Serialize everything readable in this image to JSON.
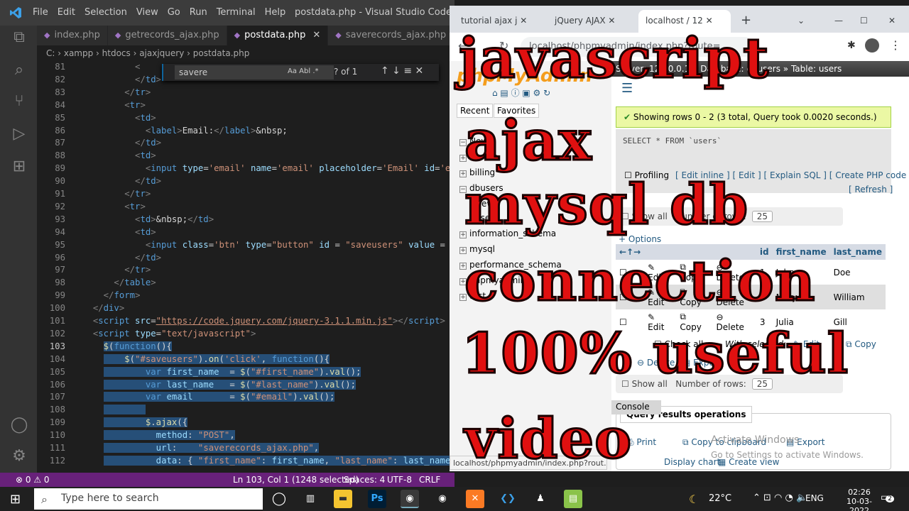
{
  "vscode": {
    "menu": [
      "File",
      "Edit",
      "Selection",
      "View",
      "Go",
      "Run",
      "Terminal",
      "Help"
    ],
    "window_title": "postdata.php - Visual Studio Code",
    "tabs": [
      {
        "label": "index.php",
        "active": false
      },
      {
        "label": "getrecords_ajax.php",
        "active": false
      },
      {
        "label": "postdata.php",
        "active": true
      },
      {
        "label": "saverecords_ajax.php",
        "active": false
      }
    ],
    "breadcrumb": "C: › xampp › htdocs › ajaxjquery › postdata.php",
    "find": {
      "query": "savere",
      "case": "Aa",
      "word": "Abl",
      "regex": ".*",
      "count": "? of 1",
      "arrows": "↑ ↓ ≡ ✕"
    },
    "lines": [
      {
        "n": "81",
        "html": "          <span class='t-punc'>&lt;</span>"
      },
      {
        "n": "82",
        "html": "          <span class='t-punc'>&lt;/</span><span class='t-tag'>td</span><span class='t-punc'>&gt;</span>"
      },
      {
        "n": "83",
        "html": "        <span class='t-punc'>&lt;/</span><span class='t-tag'>tr</span><span class='t-punc'>&gt;</span>"
      },
      {
        "n": "84",
        "html": "        <span class='t-punc'>&lt;</span><span class='t-tag'>tr</span><span class='t-punc'>&gt;</span>"
      },
      {
        "n": "85",
        "html": "          <span class='t-punc'>&lt;</span><span class='t-tag'>td</span><span class='t-punc'>&gt;</span>"
      },
      {
        "n": "86",
        "html": "            <span class='t-punc'>&lt;</span><span class='t-tag'>label</span><span class='t-punc'>&gt;</span>Email:<span class='t-punc'>&lt;/</span><span class='t-tag'>label</span><span class='t-punc'>&gt;</span>&amp;nbsp;"
      },
      {
        "n": "87",
        "html": "          <span class='t-punc'>&lt;/</span><span class='t-tag'>td</span><span class='t-punc'>&gt;</span>"
      },
      {
        "n": "88",
        "html": "          <span class='t-punc'>&lt;</span><span class='t-tag'>td</span><span class='t-punc'>&gt;</span>"
      },
      {
        "n": "89",
        "html": "            <span class='t-punc'>&lt;</span><span class='t-tag'>input</span> <span class='t-attr'>type</span>=<span class='t-str'>'email'</span> <span class='t-attr'>name</span>=<span class='t-str'>'email'</span> <span class='t-attr'>placeholder</span>=<span class='t-str'>'Email'</span> <span class='t-attr'>id</span>=<span class='t-str'>'e</span>"
      },
      {
        "n": "90",
        "html": "          <span class='t-punc'>&lt;/</span><span class='t-tag'>td</span><span class='t-punc'>&gt;</span>"
      },
      {
        "n": "91",
        "html": "        <span class='t-punc'>&lt;/</span><span class='t-tag'>tr</span><span class='t-punc'>&gt;</span>"
      },
      {
        "n": "92",
        "html": "        <span class='t-punc'>&lt;</span><span class='t-tag'>tr</span><span class='t-punc'>&gt;</span>"
      },
      {
        "n": "93",
        "html": "          <span class='t-punc'>&lt;</span><span class='t-tag'>td</span><span class='t-punc'>&gt;</span>&amp;nbsp;<span class='t-punc'>&lt;/</span><span class='t-tag'>td</span><span class='t-punc'>&gt;</span>"
      },
      {
        "n": "94",
        "html": "          <span class='t-punc'>&lt;</span><span class='t-tag'>td</span><span class='t-punc'>&gt;</span>"
      },
      {
        "n": "95",
        "html": "            <span class='t-punc'>&lt;</span><span class='t-tag'>input</span> <span class='t-attr'>class</span>=<span class='t-str'>'btn'</span> <span class='t-attr'>type</span>=<span class='t-str'>\"button\"</span> <span class='t-attr'>id</span> = <span class='t-str'>\"saveusers\"</span> <span class='t-attr'>value</span> ="
      },
      {
        "n": "96",
        "html": "          <span class='t-punc'>&lt;/</span><span class='t-tag'>td</span><span class='t-punc'>&gt;</span>"
      },
      {
        "n": "97",
        "html": "        <span class='t-punc'>&lt;/</span><span class='t-tag'>tr</span><span class='t-punc'>&gt;</span>"
      },
      {
        "n": "98",
        "html": "      <span class='t-punc'>&lt;/</span><span class='t-tag'>table</span><span class='t-punc'>&gt;</span>"
      },
      {
        "n": "99",
        "html": "    <span class='t-punc'>&lt;/</span><span class='t-tag'>form</span><span class='t-punc'>&gt;</span>"
      },
      {
        "n": "100",
        "html": "  <span class='t-punc'>&lt;/</span><span class='t-tag'>div</span><span class='t-punc'>&gt;</span>"
      },
      {
        "n": "101",
        "html": "  <span class='t-punc'>&lt;</span><span class='t-tag'>script</span> <span class='t-attr'>src</span>=<span class='t-str' style='text-decoration:underline'>\"https://code.jquery.com/jquery-3.1.1.min.js\"</span><span class='t-punc'>&gt;&lt;/</span><span class='t-tag'>script</span><span class='t-punc'>&gt;</span>"
      },
      {
        "n": "102",
        "html": "  <span class='t-punc'>&lt;</span><span class='t-tag'>script</span> <span class='t-attr'>type</span>=<span class='t-str'>\"text/javascript\"</span><span class='t-punc'>&gt;</span>"
      },
      {
        "n": "103",
        "html": "    <span class='sel'><span class='t-fn'>$</span>(<span class='t-kw'>function</span>(){</span>",
        "cur": true
      },
      {
        "n": "104",
        "html": "    <span class='sel'>    <span class='t-fn'>$</span>(<span class='t-str'>\"#saveusers\"</span>).<span class='t-fn'>on</span>(<span class='t-str'>'click'</span>, <span class='t-kw'>function</span>(){</span>"
      },
      {
        "n": "105",
        "html": "    <span class='sel'>        <span class='t-kw'>var</span> <span class='t-var'>first_name</span>  = <span class='t-fn'>$</span>(<span class='t-str'>\"#first_name\"</span>).<span class='t-fn'>val</span>();</span>"
      },
      {
        "n": "106",
        "html": "    <span class='sel'>        <span class='t-kw'>var</span> <span class='t-var'>last_name</span>   = <span class='t-fn'>$</span>(<span class='t-str'>\"#last_name\"</span>).<span class='t-fn'>val</span>();</span>"
      },
      {
        "n": "107",
        "html": "    <span class='sel'>        <span class='t-kw'>var</span> <span class='t-var'>email</span>       = <span class='t-fn'>$</span>(<span class='t-str'>\"#email\"</span>).<span class='t-fn'>val</span>();</span>"
      },
      {
        "n": "108",
        "html": "    <span class='sel'>        </span>"
      },
      {
        "n": "109",
        "html": "    <span class='sel'>        <span class='t-fn'>$</span>.<span class='t-fn'>ajax</span>({</span>"
      },
      {
        "n": "110",
        "html": "    <span class='sel'>          <span class='t-var'>method</span>: <span class='t-str'>\"POST\"</span>,</span>"
      },
      {
        "n": "111",
        "html": "    <span class='sel'>          <span class='t-var'>url</span>:    <span class='t-str'>\"saverecords_ajax.php\"</span>,</span>"
      },
      {
        "n": "112",
        "html": "    <span class='sel'>          <span class='t-var'>data</span>: { <span class='t-str'>\"first_name\"</span>: <span class='t-var'>first_name</span>, <span class='t-str'>\"last_name\"</span>: <span class='t-var'>last_name</span>,</span>"
      }
    ],
    "status": {
      "left": "⊗ 0 ⚠ 0",
      "pos": "Ln 103, Col 1 (1248 selected)",
      "spaces": "Spaces: 4",
      "enc": "UTF-8",
      "eol": "CRLF",
      "lang": "PHP"
    }
  },
  "browser": {
    "tabs": [
      {
        "label": "tutorial ajax j"
      },
      {
        "label": "jQuery AJAX"
      },
      {
        "label": "localhost / 12"
      }
    ],
    "url": "localhost/phpmyadmin/index.php?route=",
    "status_url": "localhost/phpmyadmin/index.php?rout...",
    "topbar": "Server: 127.0.0.1 » Database: dbusers » Table: users",
    "left_tabs": [
      "Recent",
      "Favorites"
    ],
    "databases": [
      "New",
      "aastha",
      "billing",
      "dbusers",
      "New",
      "users",
      "information_schema",
      "mysql",
      "performance_schema",
      "phpmyadmin",
      "test"
    ],
    "success_msg": "Showing rows 0 - 2 (3 total, Query took 0.0020 seconds.)",
    "sql": "SELECT * FROM `users`",
    "profiling": "Profiling",
    "links": "[ Edit inline ] [ Edit ] [ Explain SQL ] [ Create PHP code ]",
    "refresh": "[ Refresh ]",
    "show_all": "Show all",
    "num_rows_label": "Number of rows:",
    "num_rows_value": "25",
    "options": "+ Options",
    "columns": [
      "",
      "",
      "",
      "",
      "id",
      "first_name",
      "last_name"
    ],
    "rows": [
      {
        "edit": "Edit",
        "copy": "Copy",
        "delete": "Delete",
        "id": "1",
        "first_name": "John",
        "last_name": "Doe"
      },
      {
        "edit": "Edit",
        "copy": "Copy",
        "delete": "Delete",
        "id": "2",
        "first_name": "Mary",
        "last_name": "William"
      },
      {
        "edit": "Edit",
        "copy": "Copy",
        "delete": "Delete",
        "id": "3",
        "first_name": "Julia",
        "last_name": "Gill"
      }
    ],
    "check_all": "Check all",
    "with_selected": "With selected:",
    "ws_edit": "Edit",
    "ws_copy": "Copy",
    "ws_delete": "Delete",
    "ws_export": "Export",
    "qro_title": "Query results operations",
    "print": "Print",
    "copy_clip": "Copy to clipboard",
    "export": "Export",
    "display_chart": "Display chart",
    "create_view": "Create view",
    "console": "Console",
    "activate1": "Activate Windows",
    "activate2": "Go to Settings to activate Windows."
  },
  "overlay": {
    "line1": "javascript",
    "line2": "ajax",
    "line3": "mysql db",
    "line4": "connection",
    "line5": "100% useful",
    "line6": "video"
  },
  "taskbar": {
    "search_placeholder": "Type here to search",
    "temp": "22°C",
    "lang": "ENG",
    "time": "02:26",
    "date": "10-03-2022",
    "notif": "2"
  }
}
